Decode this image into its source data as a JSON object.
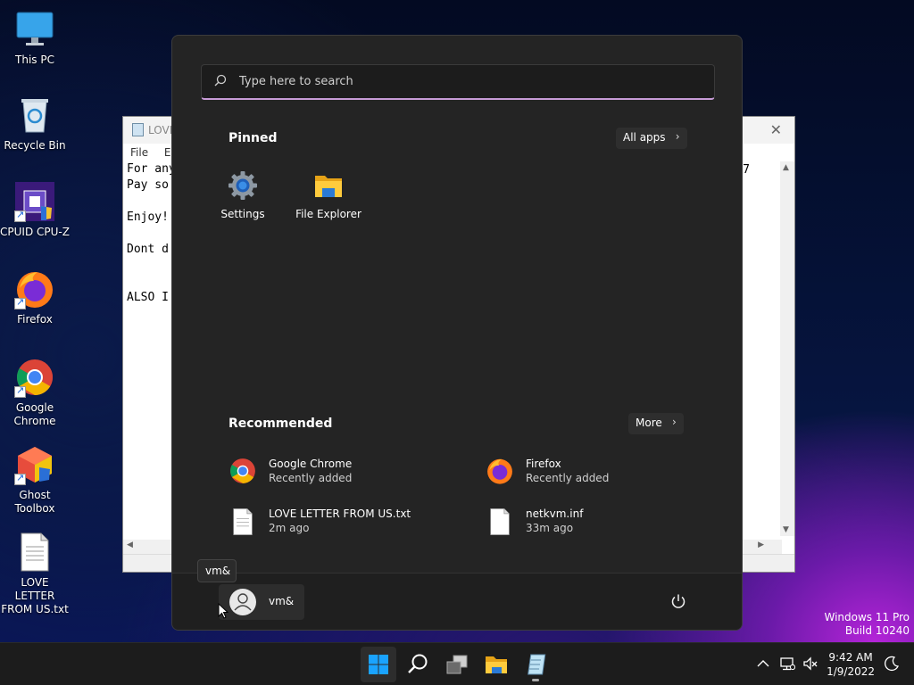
{
  "desktop": {
    "icons": [
      {
        "label": "This PC"
      },
      {
        "label": "Recycle Bin"
      },
      {
        "label": "CPUID CPU-Z"
      },
      {
        "label": "Firefox"
      },
      {
        "label": "Google Chrome"
      },
      {
        "label": "Ghost Toolbox"
      },
      {
        "label": "LOVE LETTER FROM US.txt"
      }
    ]
  },
  "notepad": {
    "title": "LOVE",
    "menu": [
      "File",
      "Edi"
    ],
    "lines": [
      "For any",
      "Pay so",
      "",
      "Enjoy!",
      "",
      "Dont d",
      "",
      "",
      "ALSO I"
    ],
    "right_char": "7"
  },
  "start_menu": {
    "search_placeholder": "Type here to search",
    "pinned_title": "Pinned",
    "all_apps_label": "All apps",
    "pinned": [
      {
        "label": "Settings",
        "icon": "gear-icon"
      },
      {
        "label": "File Explorer",
        "icon": "folder-icon"
      }
    ],
    "recommended_title": "Recommended",
    "more_label": "More",
    "recommended": [
      {
        "name": "Google Chrome",
        "sub": "Recently added",
        "icon": "chrome-icon"
      },
      {
        "name": "Firefox",
        "sub": "Recently added",
        "icon": "firefox-icon"
      },
      {
        "name": "LOVE LETTER FROM US.txt",
        "sub": "2m ago",
        "icon": "text-file-icon"
      },
      {
        "name": "netkvm.inf",
        "sub": "33m ago",
        "icon": "text-file-icon"
      }
    ],
    "user_name": "vm&",
    "tooltip": "vm&"
  },
  "watermark": {
    "line1": "Windows 11 Pro",
    "line2": "Build 10240"
  },
  "taskbar": {
    "items": [
      "start-button",
      "search-button",
      "task-view-button",
      "file-explorer-button",
      "notepad-button"
    ],
    "time": "9:42 AM",
    "date": "1/9/2022"
  },
  "colors": {
    "accent": "#0078d4",
    "search_underline": "#c79bd6",
    "start_bg": "#242424"
  }
}
